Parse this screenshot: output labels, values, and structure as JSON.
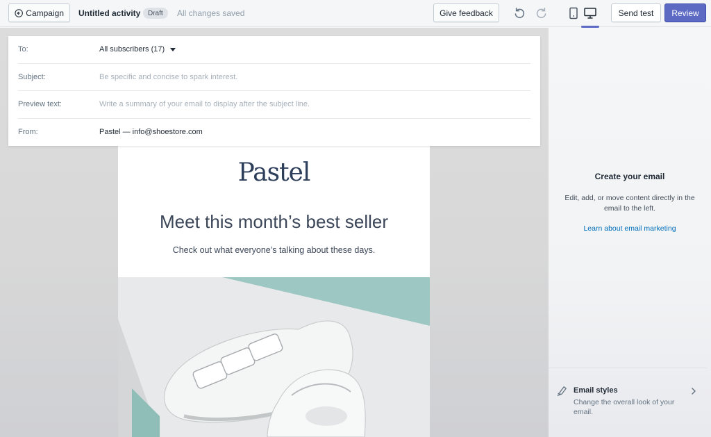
{
  "topbar": {
    "back_label": "Campaign",
    "activity_title": "Untitled activity",
    "status_badge": "Draft",
    "save_status": "All changes saved",
    "feedback_label": "Give feedback",
    "send_test_label": "Send test",
    "review_label": "Review",
    "accent_color": "#5c6ac4"
  },
  "email_meta": {
    "to_label": "To:",
    "to_value": "All subscribers (17)",
    "subject_label": "Subject:",
    "subject_placeholder": "Be specific and concise to spark interest.",
    "preview_label": "Preview text:",
    "preview_placeholder": "Write a summary of your email to display after the subject line.",
    "from_label": "From:",
    "from_value": "Pastel — info@shoestore.com"
  },
  "email_content": {
    "logo_text": "Pastel",
    "headline": "Meet this month’s best seller",
    "subheadline": "Check out what everyone’s talking about these days."
  },
  "side_panel": {
    "title": "Create your email",
    "description": "Edit, add, or move content directly in the email to the left.",
    "link_label": "Learn about email marketing",
    "styles_title": "Email styles",
    "styles_description": "Change the overall look of your email."
  }
}
